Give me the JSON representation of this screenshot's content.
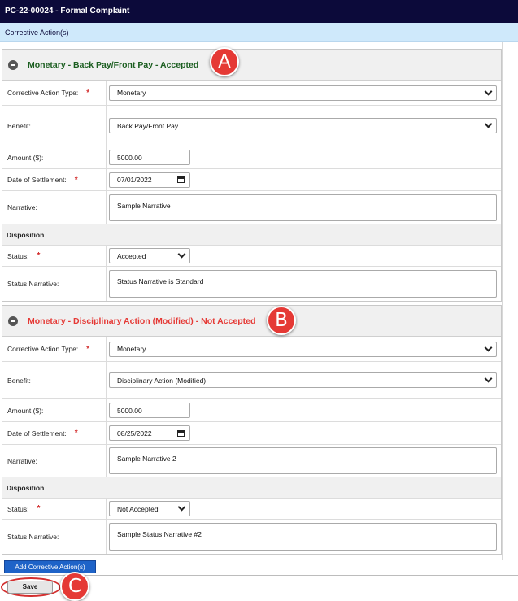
{
  "header": {
    "title": "PC-22-00024 - Formal Complaint"
  },
  "subheader": {
    "title": "Corrective Action(s)"
  },
  "labels": {
    "corrective_action_type": "Corrective Action Type:",
    "benefit": "Benefit:",
    "amount": "Amount ($):",
    "date_of_settlement": "Date of Settlement:",
    "narrative": "Narrative:",
    "disposition": "Disposition",
    "status": "Status:",
    "status_narrative": "Status Narrative:",
    "required_marker": "*"
  },
  "actions": [
    {
      "title": "Monetary - Back Pay/Front Pay - Accepted",
      "title_color": "#1b5e20",
      "corrective_action_type": "Monetary",
      "benefit": "Back Pay/Front Pay",
      "amount": "5000.00",
      "date_of_settlement": "07/01/2022",
      "narrative": "Sample Narrative",
      "status": "Accepted",
      "status_narrative": "Status Narrative is Standard",
      "callout": "A"
    },
    {
      "title": "Monetary - Disciplinary Action (Modified) - Not Accepted",
      "title_color": "#e53935",
      "corrective_action_type": "Monetary",
      "benefit": "Disciplinary Action (Modified)",
      "amount": "5000.00",
      "date_of_settlement": "08/25/2022",
      "narrative": "Sample Narrative 2",
      "status": "Not Accepted",
      "status_narrative": "Sample Status Narrative #2",
      "callout": "B"
    }
  ],
  "buttons": {
    "add_corrective_action": "Add Corrective Action(s)",
    "save": "Save"
  },
  "callouts": {
    "save": "C"
  },
  "colors": {
    "header_bg": "#0c0a3a",
    "subheader_bg": "#cfe9fb",
    "accent": "#1e63c8",
    "callout": "#e53935"
  }
}
